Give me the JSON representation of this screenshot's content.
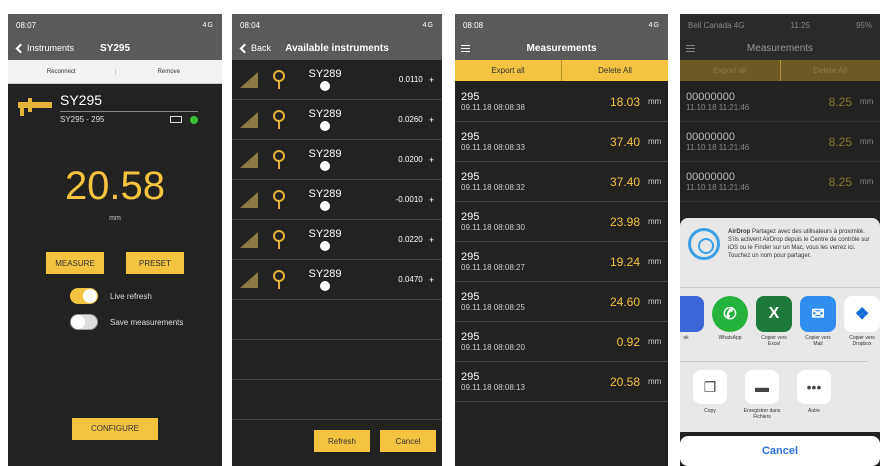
{
  "screen1": {
    "status": {
      "time": "08:07",
      "signal": "4G"
    },
    "nav": {
      "back_label": "Instruments",
      "title": "SY295"
    },
    "segments": [
      "Reconnect",
      "Remove"
    ],
    "device": {
      "name": "SY295",
      "subtitle": "SY295 - 295"
    },
    "reading": {
      "value": "20.58",
      "unit": "mm"
    },
    "buttons": {
      "measure": "MEASURE",
      "preset": "PRESET",
      "configure": "CONFIGURE"
    },
    "toggles": [
      {
        "label": "Live refresh",
        "on": true
      },
      {
        "label": "Save measurements",
        "on": false
      }
    ],
    "colors": {
      "accent": "#f4c33f",
      "connected": "#3bbf3b"
    }
  },
  "screen2": {
    "status": {
      "time": "08:04",
      "signal": "4G"
    },
    "nav": {
      "back_label": "Back",
      "title": "Available instruments"
    },
    "instruments": [
      {
        "name": "SY289",
        "value": "0.0110",
        "action": "+"
      },
      {
        "name": "SY289",
        "value": "0.0260",
        "action": "+"
      },
      {
        "name": "SY289",
        "value": "0.0200",
        "action": "+"
      },
      {
        "name": "SY289",
        "value": "-0.0010",
        "action": "+"
      },
      {
        "name": "SY289",
        "value": "0.0220",
        "action": "+"
      },
      {
        "name": "SY289",
        "value": "0.0470",
        "action": "+"
      }
    ],
    "buttons": {
      "refresh": "Refresh",
      "cancel": "Cancel"
    }
  },
  "screen3": {
    "status": {
      "time": "08:08",
      "signal": "4G"
    },
    "nav": {
      "title": "Measurements",
      "menu_icon": "hamburger-icon"
    },
    "buttons": {
      "export": "Export all",
      "delete": "Delete All"
    },
    "measurements": [
      {
        "code": "295",
        "timestamp": "09.11.18 08:08:38",
        "value": "18.03",
        "unit": "mm"
      },
      {
        "code": "295",
        "timestamp": "09.11.18 08:08:33",
        "value": "37.40",
        "unit": "mm"
      },
      {
        "code": "295",
        "timestamp": "09.11.18 08:08:32",
        "value": "37.40",
        "unit": "mm"
      },
      {
        "code": "295",
        "timestamp": "09.11.18 08:08:30",
        "value": "23.98",
        "unit": "mm"
      },
      {
        "code": "295",
        "timestamp": "09.11.18 08:08:27",
        "value": "19.24",
        "unit": "mm"
      },
      {
        "code": "295",
        "timestamp": "09.11.18 08:08:25",
        "value": "24.60",
        "unit": "mm"
      },
      {
        "code": "295",
        "timestamp": "09.11.18 08:08:20",
        "value": "0.92",
        "unit": "mm"
      },
      {
        "code": "295",
        "timestamp": "09.11.18 08:08:13",
        "value": "20.58",
        "unit": "mm"
      }
    ]
  },
  "screen4": {
    "status": {
      "carrier": "Bell Canada 4G",
      "time": "11:25",
      "battery": "95%"
    },
    "nav": {
      "title": "Measurements"
    },
    "buttons": {
      "export": "Export all",
      "delete": "Delete All"
    },
    "measurements": [
      {
        "code": "00000000",
        "timestamp": "11.10.18 11:21:46",
        "value": "8.25",
        "unit": "mm"
      },
      {
        "code": "00000000",
        "timestamp": "11.10.18 11:21:46",
        "value": "8.25",
        "unit": "mm"
      },
      {
        "code": "00000000",
        "timestamp": "11.10.18 11:21:46",
        "value": "8.25",
        "unit": "mm"
      }
    ],
    "share_sheet": {
      "airdrop_title": "AirDrop",
      "airdrop_text": "Partagez avec des utilisateurs à proximité. S'ils activent AirDrop depuis le Centre de contrôle sur iOS ou le Finder sur un Mac, vous les verrez ici. Touchez un nom pour partager.",
      "apps": [
        {
          "label": "ok",
          "icon": "partial-app-icon",
          "color": "#3a66d6"
        },
        {
          "label": "WhatsApp",
          "icon": "whatsapp-icon",
          "color": "#25b33d"
        },
        {
          "label": "Copier vers Excel",
          "icon": "excel-icon",
          "color": "#1e7a3c"
        },
        {
          "label": "Copier vers Mail",
          "icon": "mail-icon",
          "color": "#2f8ef0"
        },
        {
          "label": "Copier vers Dropbox",
          "icon": "dropbox-icon",
          "color": "#1268d8"
        }
      ],
      "actions": [
        {
          "label": "Copy",
          "icon": "copy-icon"
        },
        {
          "label": "Enregistrer dans Fichiers",
          "icon": "folder-icon"
        },
        {
          "label": "Autre",
          "icon": "more-icon"
        }
      ],
      "cancel": "Cancel"
    }
  }
}
